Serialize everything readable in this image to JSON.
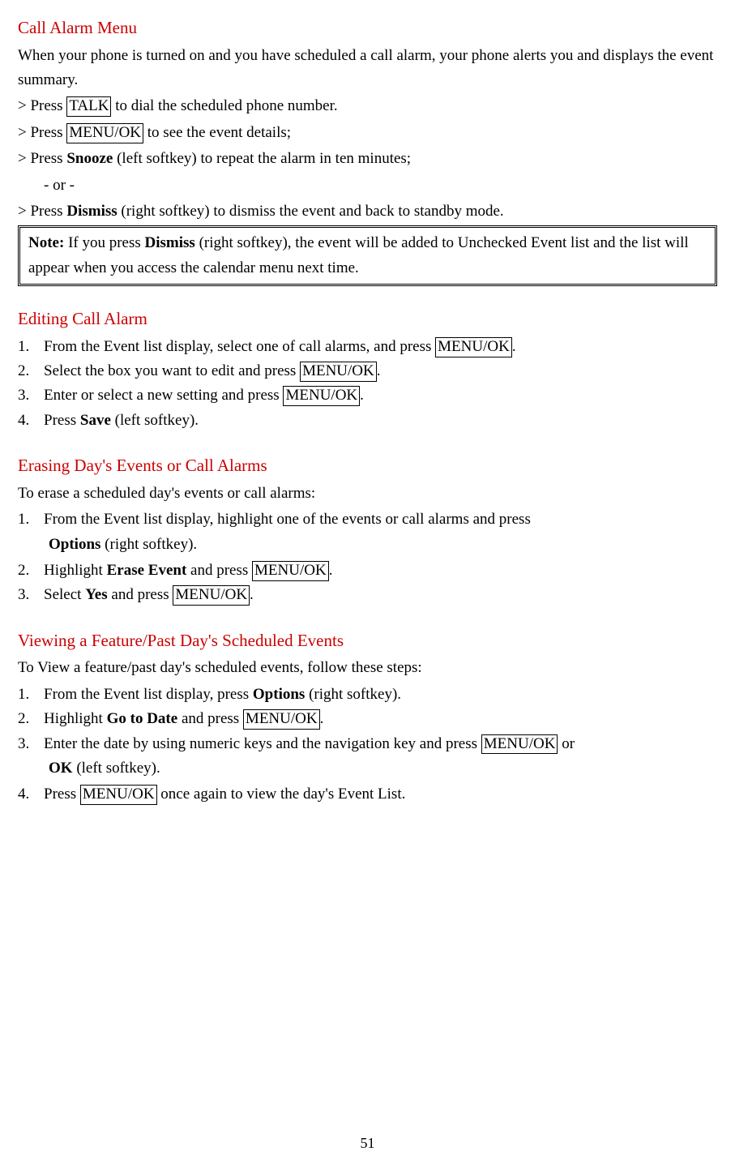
{
  "section1": {
    "heading": "Call Alarm Menu",
    "intro": "When your phone is turned on and you have scheduled a call alarm, your phone alerts you and displays the event summary.",
    "line1_pre": "> Press ",
    "line1_box": "TALK",
    "line1_post": " to dial the scheduled phone number.",
    "line2_pre": "> Press ",
    "line2_box": "MENU/OK",
    "line2_post": " to see the event details;",
    "line3_pre": "> Press ",
    "line3_bold": "Snooze",
    "line3_post": " (left softkey) to repeat the alarm in ten minutes;",
    "line4": "- or -",
    "line5_pre": "> Press ",
    "line5_bold": "Dismiss",
    "line5_post": " (right softkey) to dismiss the event and back to standby mode.",
    "note_label": "Note:",
    "note_text1": " If you press ",
    "note_bold": "Dismiss",
    "note_text2": " (right softkey), the event will be added to Unchecked Event list and the list will appear when you access the calendar menu next time."
  },
  "section2": {
    "heading": "Editing Call Alarm",
    "item1_num": "1.",
    "item1_text1": "From the Event list display, select one of call alarms, and press ",
    "item1_box": "MENU/OK",
    "item1_text2": ".",
    "item2_num": "2.",
    "item2_text1": "Select the box you want to edit and press ",
    "item2_box": "MENU/OK",
    "item2_text2": ".",
    "item3_num": "3.",
    "item3_text1": "Enter or select a new setting and press ",
    "item3_box": "MENU/OK",
    "item3_text2": ".",
    "item4_num": "4.",
    "item4_text1": "Press ",
    "item4_bold": "Save",
    "item4_text2": " (left softkey)."
  },
  "section3": {
    "heading": "Erasing Day's Events or Call Alarms",
    "intro": "To erase a scheduled day's events or call alarms:",
    "item1_num": "1.",
    "item1_text": "From the Event list display, highlight one of the events or call alarms and press",
    "item1_cont_bold": "Options",
    "item1_cont_text": " (right softkey).",
    "item2_num": "2.",
    "item2_text1": "Highlight ",
    "item2_bold": "Erase Event",
    "item2_text2": " and press ",
    "item2_box": "MENU/OK",
    "item2_text3": ".",
    "item3_num": "3.",
    "item3_text1": "Select ",
    "item3_bold": "Yes",
    "item3_text2": " and press ",
    "item3_box": "MENU/OK",
    "item3_text3": "."
  },
  "section4": {
    "heading": "Viewing a Feature/Past Day's Scheduled Events",
    "intro": "To View a feature/past day's scheduled events, follow these steps:",
    "item1_num": "1.",
    "item1_text1": "From the Event list display, press ",
    "item1_bold": "Options",
    "item1_text2": " (right softkey).",
    "item2_num": "2.",
    "item2_text1": "Highlight ",
    "item2_bold": "Go to Date",
    "item2_text2": " and press ",
    "item2_box": "MENU/OK",
    "item2_text3": ".",
    "item3_num": "3.",
    "item3_text1": "Enter the date by using numeric keys and the navigation key and press ",
    "item3_box": "MENU/OK",
    "item3_text2": " or",
    "item3_cont_bold": "OK",
    "item3_cont_text": " (left softkey).",
    "item4_num": "4.",
    "item4_text1": "Press ",
    "item4_box": "MENU/OK",
    "item4_text2": " once again to view the day's Event List."
  },
  "page_number": "51"
}
